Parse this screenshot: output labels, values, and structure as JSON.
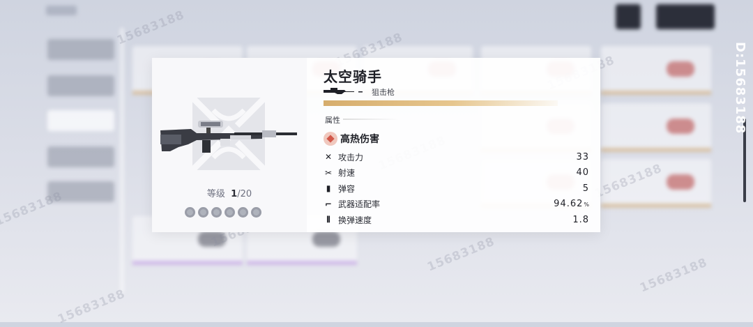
{
  "background": {
    "watermark_text": "15683188",
    "side_watermark": "D:15683188"
  },
  "weapon": {
    "name": "太空骑手",
    "type": "狙击枪",
    "level_label": "等级",
    "level_current": "1",
    "level_max": "/20",
    "stars_total": 6,
    "stars_filled": 0,
    "rarity_color": "#d6ad6c"
  },
  "attributes": {
    "section_label": "属性",
    "element": {
      "name": "高热伤害",
      "icon": "fire-element-icon",
      "color": "#d2584a"
    },
    "stats": [
      {
        "icon": "attack-icon",
        "name": "攻击力",
        "value": "33",
        "unit": ""
      },
      {
        "icon": "fire-rate-icon",
        "name": "射速",
        "value": "40",
        "unit": ""
      },
      {
        "icon": "magazine-icon",
        "name": "弹容",
        "value": "5",
        "unit": ""
      },
      {
        "icon": "weapon-fit-icon",
        "name": "武器适配率",
        "value": "94.62",
        "unit": "%"
      },
      {
        "icon": "reload-icon",
        "name": "换弹速度",
        "value": "1.8",
        "unit": ""
      }
    ]
  }
}
